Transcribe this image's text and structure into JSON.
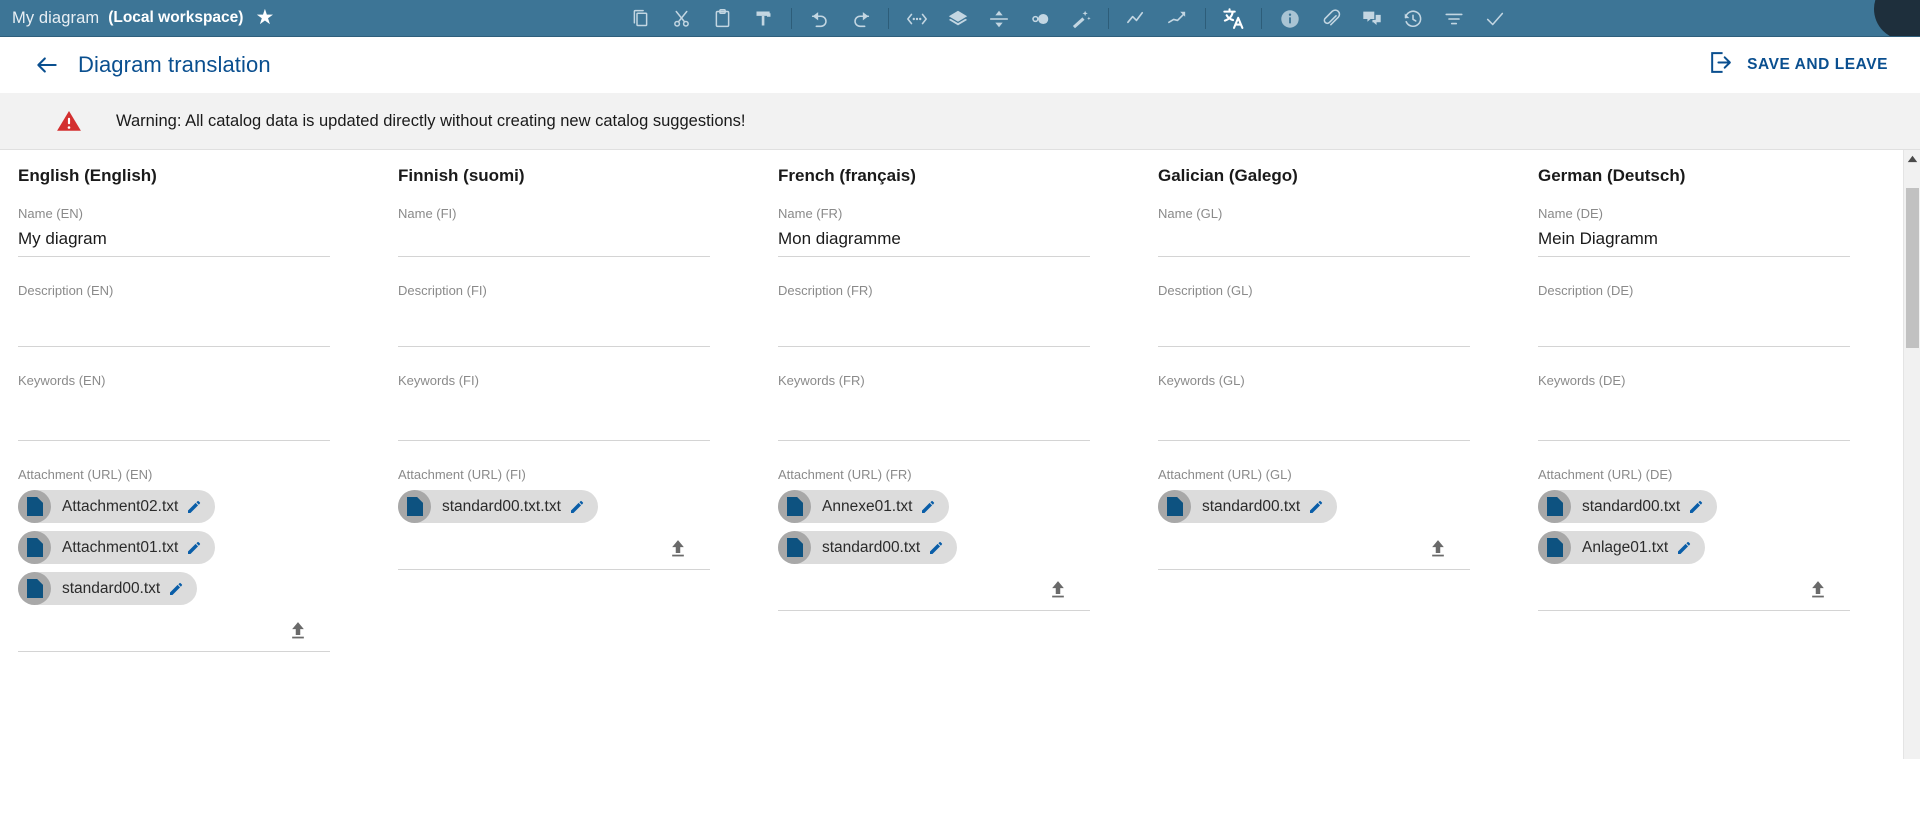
{
  "appbar": {
    "document_name": "My diagram",
    "workspace": "(Local workspace)",
    "favorite_icon": "star-icon",
    "tools": [
      {
        "name": "copy-icon",
        "label": "Copy"
      },
      {
        "name": "cut-icon",
        "label": "Cut"
      },
      {
        "name": "paste-icon",
        "label": "Paste"
      },
      {
        "name": "format-painter-icon",
        "label": "Format painter"
      },
      {
        "name": "undo-icon",
        "label": "Undo"
      },
      {
        "name": "redo-icon",
        "label": "Redo"
      },
      {
        "name": "distribute-horizontal-icon",
        "label": "Distribute horizontally"
      },
      {
        "name": "layers-icon",
        "label": "Layers"
      },
      {
        "name": "distribute-vertical-icon",
        "label": "Distribute vertically"
      },
      {
        "name": "resize-shapes-icon",
        "label": "Resize shapes"
      },
      {
        "name": "magic-wand-icon",
        "label": "Magic wand"
      },
      {
        "name": "line-style-icon",
        "label": "Line style"
      },
      {
        "name": "trend-line-icon",
        "label": "Trend line"
      },
      {
        "name": "translate-icon",
        "label": "Translate"
      },
      {
        "name": "info-icon",
        "label": "Information"
      },
      {
        "name": "attachment-icon",
        "label": "Attachments"
      },
      {
        "name": "comment-icon",
        "label": "Comments"
      },
      {
        "name": "history-icon",
        "label": "History"
      },
      {
        "name": "filter-icon",
        "label": "Filter"
      },
      {
        "name": "check-icon",
        "label": "Approve"
      }
    ]
  },
  "header": {
    "back_icon": "back-arrow-icon",
    "title": "Diagram translation",
    "save_and_leave_label": "SAVE AND LEAVE",
    "save_and_leave_icon": "exit-arrow-icon"
  },
  "warning": {
    "icon": "warning-triangle-icon",
    "text": "Warning: All catalog data is updated directly without creating new catalog suggestions!",
    "color": "#d32f2f",
    "background": "#f2f2f2"
  },
  "columns": [
    {
      "title": "English (English)",
      "name_label": "Name (EN)",
      "name_value": "My diagram",
      "description_label": "Description (EN)",
      "description_value": "",
      "keywords_label": "Keywords (EN)",
      "keywords_value": "",
      "attachment_label": "Attachment (URL) (EN)",
      "attachments": [
        "Attachment02.txt",
        "Attachment01.txt",
        "standard00.txt"
      ]
    },
    {
      "title": "Finnish (suomi)",
      "name_label": "Name (FI)",
      "name_value": "",
      "description_label": "Description (FI)",
      "description_value": "",
      "keywords_label": "Keywords (FI)",
      "keywords_value": "",
      "attachment_label": "Attachment (URL) (FI)",
      "attachments": [
        "standard00.txt.txt"
      ]
    },
    {
      "title": "French (français)",
      "name_label": "Name (FR)",
      "name_value": "Mon diagramme",
      "description_label": "Description (FR)",
      "description_value": "",
      "keywords_label": "Keywords (FR)",
      "keywords_value": "",
      "attachment_label": "Attachment (URL) (FR)",
      "attachments": [
        "Annexe01.txt",
        "standard00.txt"
      ]
    },
    {
      "title": "Galician (Galego)",
      "name_label": "Name (GL)",
      "name_value": "",
      "description_label": "Description (GL)",
      "description_value": "",
      "keywords_label": "Keywords (GL)",
      "keywords_value": "",
      "attachment_label": "Attachment (URL) (GL)",
      "attachments": [
        "standard00.txt"
      ]
    },
    {
      "title": "German (Deutsch)",
      "name_label": "Name (DE)",
      "name_value": "Mein Diagramm",
      "description_label": "Description (DE)",
      "description_value": "",
      "keywords_label": "Keywords (DE)",
      "keywords_value": "",
      "attachment_label": "Attachment (URL) (DE)",
      "attachments": [
        "standard00.txt",
        "Anlage01.txt"
      ]
    }
  ],
  "chip": {
    "file_icon": "document-icon",
    "edit_icon": "pencil-icon"
  },
  "upload": {
    "icon": "upload-icon"
  },
  "scrollbar": {
    "up_icon": "scroll-up-arrow-icon"
  },
  "theme": {
    "appbar_bg": "#3d7596",
    "accent_blue": "#0a4f8f",
    "chip_bg": "#dcdcdc",
    "warning_red": "#d32f2f"
  }
}
